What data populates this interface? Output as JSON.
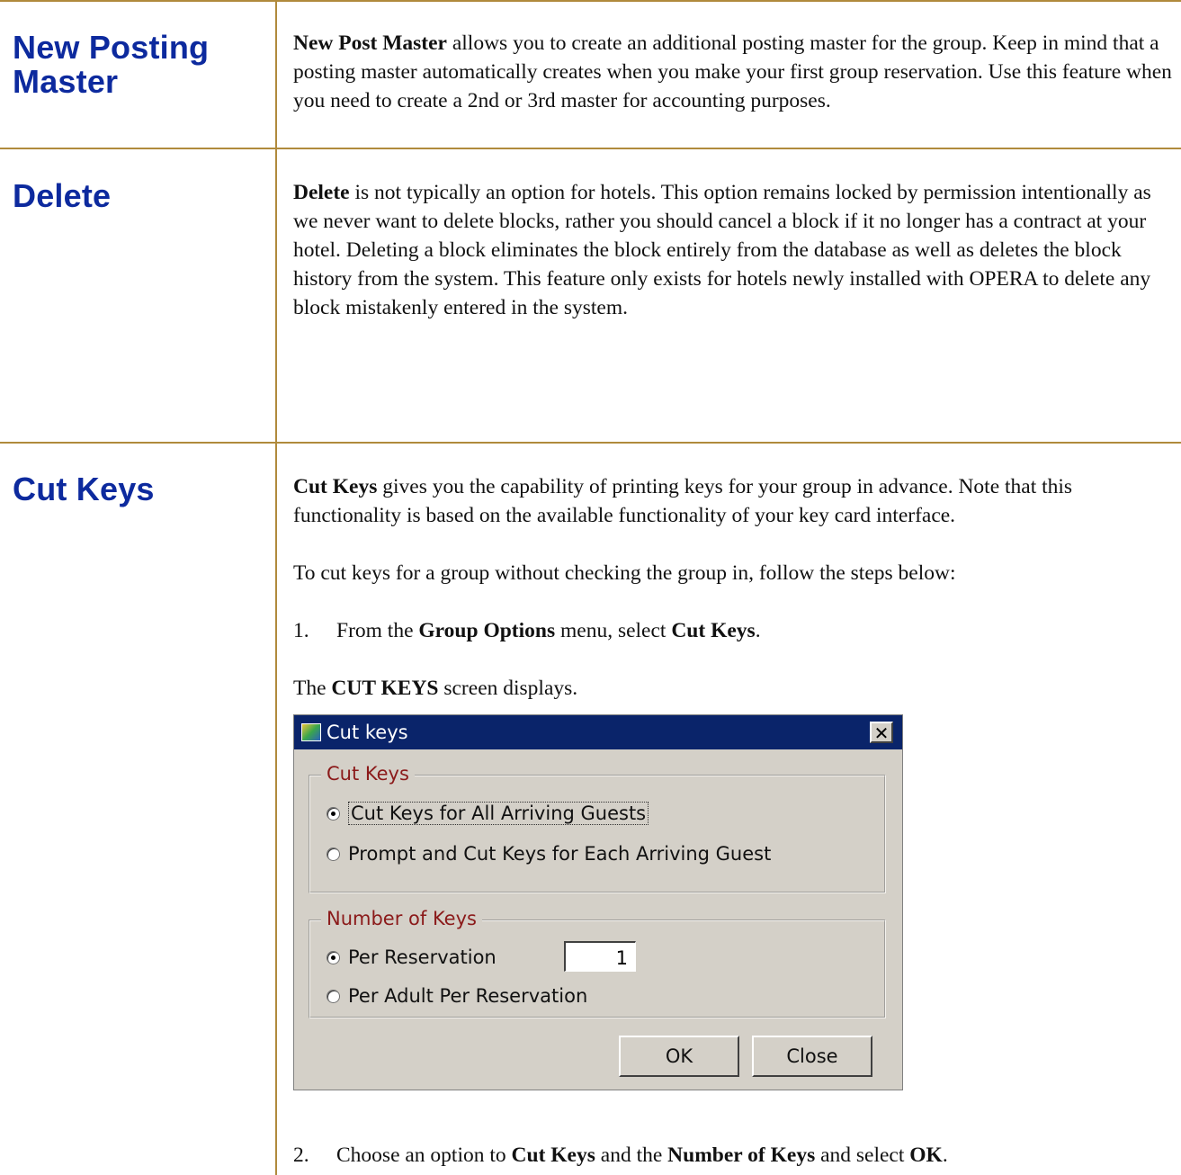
{
  "sections": [
    {
      "heading_line1": "New Posting",
      "heading_line2": "Master",
      "term": "New Post Master",
      "text": " allows you to create an additional posting master for the group.  Keep in mind that a posting master automatically creates when you make your first group reservation.  Use this feature when you need to create a 2nd or 3rd master for accounting purposes."
    },
    {
      "heading": "Delete",
      "term": "Delete",
      "text": " is not typically an option for hotels.  This option remains locked by permission intentionally as we never want to delete blocks, rather you should cancel a block if it no longer has a contract at your hotel.  Deleting a block eliminates the block entirely from the database as well as deletes the block history from the system.  This feature only exists for hotels newly installed with OPERA to delete any block mistakenly entered in the system."
    },
    {
      "heading": "Cut Keys",
      "term": "Cut Keys",
      "text": " gives you the capability of printing keys for your group in advance. Note that this functionality is based on the available functionality of your key card interface.",
      "intro": "To cut keys for a group without checking the group in, follow the steps below:",
      "step1": {
        "num": "1.",
        "pre": "From the ",
        "b1": "Group Options",
        "mid": " menu, select ",
        "b2": "Cut Keys",
        "post": "."
      },
      "screen_note": {
        "pre": "The ",
        "b": "CUT KEYS",
        "post": " screen displays."
      },
      "step2": {
        "num": "2.",
        "pre": "Choose an option to ",
        "b1": "Cut Keys",
        "mid": " and the ",
        "b2": "Number of Keys",
        "mid2": " and select ",
        "b3": "OK",
        "post": "."
      }
    }
  ],
  "dialog": {
    "title": "Cut keys",
    "close_glyph": "✕",
    "group1_label": "Cut Keys",
    "option_all": "Cut Keys for All Arriving Guests",
    "option_each": "Prompt and Cut Keys for Each Arriving Guest",
    "group2_label": "Number of Keys",
    "option_per_res": "Per Reservation",
    "per_res_value": "1",
    "option_per_adult": "Per Adult Per Reservation",
    "ok_label": "OK",
    "close_label": "Close"
  },
  "colors": {
    "heading": "#0d2a9e",
    "rule": "#b08a3c",
    "dialog_titlebar": "#0a246a",
    "group_label": "#8b1a1a"
  }
}
